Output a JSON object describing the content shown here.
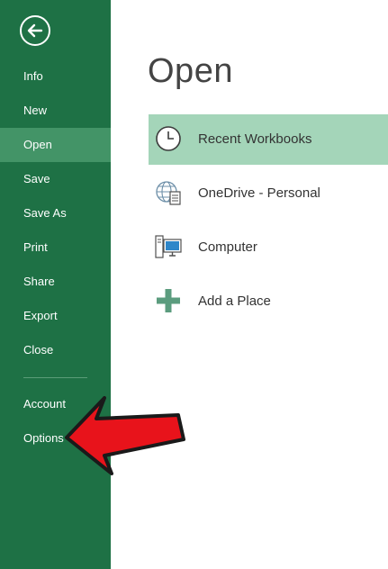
{
  "backstage": {
    "title": "Open",
    "nav": [
      {
        "label": "Info"
      },
      {
        "label": "New"
      },
      {
        "label": "Open"
      },
      {
        "label": "Save"
      },
      {
        "label": "Save As"
      },
      {
        "label": "Print"
      },
      {
        "label": "Share"
      },
      {
        "label": "Export"
      },
      {
        "label": "Close"
      },
      {
        "label": "Account"
      },
      {
        "label": "Options"
      }
    ],
    "active_nav": "Open",
    "places": [
      {
        "label": "Recent Workbooks",
        "icon": "clock-icon",
        "selected": true
      },
      {
        "label": "OneDrive - Personal",
        "icon": "globe-document-icon",
        "selected": false
      },
      {
        "label": "Computer",
        "icon": "computer-icon",
        "selected": false
      },
      {
        "label": "Add a Place",
        "icon": "plus-icon",
        "selected": false
      }
    ]
  },
  "annotation": {
    "icon": "red-arrow-icon",
    "color": "#e8131b",
    "points_to": "Options"
  },
  "colors": {
    "sidebar": "#1e7145",
    "sidebar_active": "#439467",
    "selected_place": "#a4d5b9",
    "accent": "#217346"
  }
}
